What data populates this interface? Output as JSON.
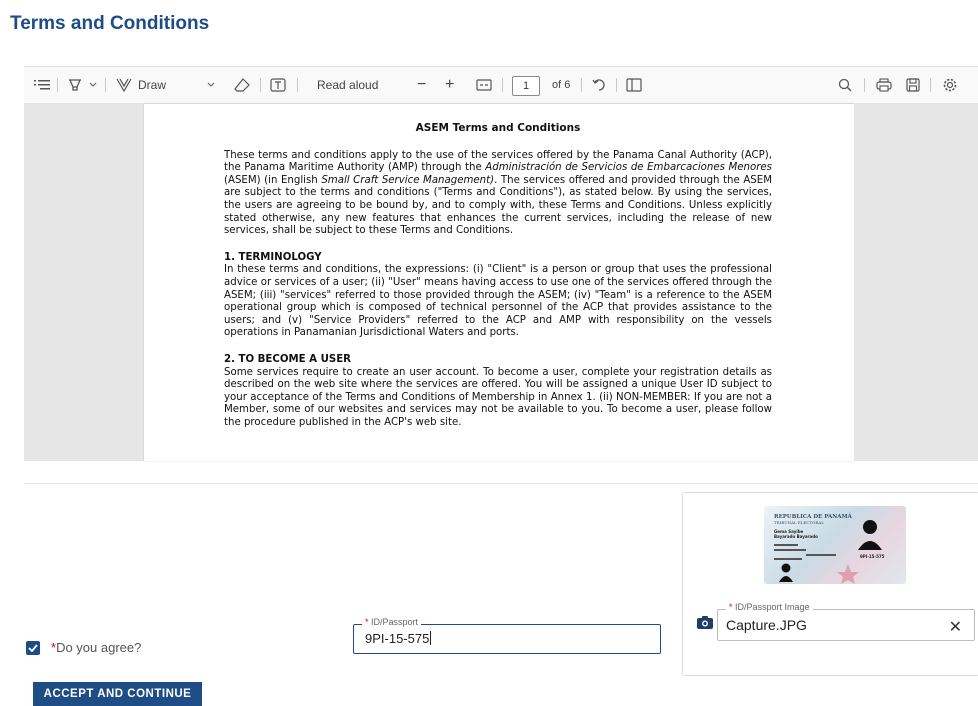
{
  "page_title": "Terms and Conditions",
  "toolbar": {
    "draw_label": "Draw",
    "read_aloud_label": "Read aloud",
    "minus_label": "−",
    "plus_label": "+",
    "page_number": "1",
    "page_of": "of 6"
  },
  "document": {
    "title": "ASEM Terms and Conditions",
    "intro": {
      "p1": "These terms and conditions apply to the use of the services offered by the Panama Canal Authority (ACP), the Panama Maritime Authority (AMP) through the ",
      "p1_italic": "Administración de Servicios de Embarcaciones Menores",
      "p2": " (ASEM) (in English ",
      "p2_italic": "Small Craft Service Management)",
      "p3": ". The services offered and provided through the ASEM are subject to the terms and conditions (\"Terms and Conditions\"), as stated below. By using the services, the users are agreeing to be bound by, and to comply with, these Terms and Conditions. Unless explicitly stated otherwise, any new features that enhances the current services, including the release of new services, shall be subject to these Terms and Conditions."
    },
    "sections": [
      {
        "heading": "1. TERMINOLOGY",
        "body": "In these terms and conditions, the expressions: (i) \"Client\" is a person or group that uses the professional advice or services of a user; (ii) \"User\" means having access to use one of the services offered through the ASEM; (iii) \"services\" referred to those provided through the ASEM; (iv) \"Team\" is a reference to the ASEM operational group which is composed of technical personnel of the ACP that provides assistance to the users; and (v) \"Service Providers\" referred to the ACP and AMP with responsibility on the vessels operations in Panamanian Jurisdictional Waters and ports."
      },
      {
        "heading": "2. TO BECOME A USER",
        "body": "Some services require to create an user account. To become a user, complete your registration details as described on the web site where the services are offered. You will be assigned a unique User ID subject to your acceptance of the Terms and Conditions of Membership in Annex 1. (ii) NON-MEMBER: If you are not a Member, some of our websites and services may not be available to you. To become a user, please follow the procedure published in the ACP's web site."
      }
    ]
  },
  "form": {
    "agree_required_mark": "*",
    "agree_label": "Do you agree?",
    "agree_checked": true,
    "id_field": {
      "required_mark": "*",
      "label": " ID/Passport",
      "value": "9PI-15-575"
    },
    "id_image_field": {
      "required_mark": "*",
      "label": " ID/Passport Image",
      "value": "Capture.JPG",
      "clear_label": "✕"
    },
    "id_card_preview": {
      "line1": "REPUBLICA DE PANAMÁ",
      "line2": "TRIBUNAL ELECTORAL",
      "name1": "Gema Sayibe",
      "name2": "Bayarado Bayarado",
      "number": "9PI-15-575"
    },
    "accept_button": "ACCEPT AND CONTINUE"
  },
  "colors": {
    "brand": "#1e4d86",
    "required": "#d0021b"
  },
  "icons": [
    "contents-icon",
    "highlight-icon",
    "draw-icon",
    "eraser-icon",
    "text-icon",
    "fit-page-icon",
    "rotate-icon",
    "page-view-icon",
    "search-icon",
    "print-icon",
    "save-icon",
    "settings-icon",
    "camera-icon"
  ]
}
